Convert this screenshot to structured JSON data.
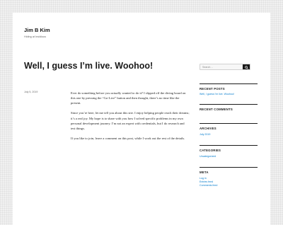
{
  "site": {
    "title": "Jim B Kim",
    "description": "Hiding at Insidious"
  },
  "post": {
    "title": "Well, I guess I’m live. Woohoo!",
    "date": "July 5, 2019",
    "paragraphs": [
      "Ever do something before you actually wanted to do it? I slipped off the diving board on this one by pressing the “Go-Live” button and then thought, there’s no time like the present.",
      "Since you’re here, let me tell you about this site. I enjoy helping people reach their dreams; it’s a real joy. My hope is to share with you how I solved specific problems in my own personal development journey. I’m not an expert with credentials, but I do research and test things.",
      "If you like to join, leave a comment on this post, while I work out the rest of the details."
    ]
  },
  "sidebar": {
    "search": {
      "placeholder": "Search…",
      "icon": "search-icon"
    },
    "recent_posts": {
      "title": "RECENT POSTS",
      "items": [
        "Well, I guess I’m live. Woohoo!"
      ]
    },
    "recent_comments": {
      "title": "RECENT COMMENTS"
    },
    "archives": {
      "title": "ARCHIVES",
      "items": [
        "July 2019"
      ]
    },
    "categories": {
      "title": "CATEGORIES",
      "items": [
        "Uncategorized"
      ]
    },
    "meta": {
      "title": "META",
      "items": [
        "Log in",
        "Entries feed",
        "Comments feed"
      ]
    }
  },
  "colors": {
    "link": "#007acc",
    "text": "#1a1a1a",
    "muted": "#686868",
    "background": "#f1f1f1"
  }
}
